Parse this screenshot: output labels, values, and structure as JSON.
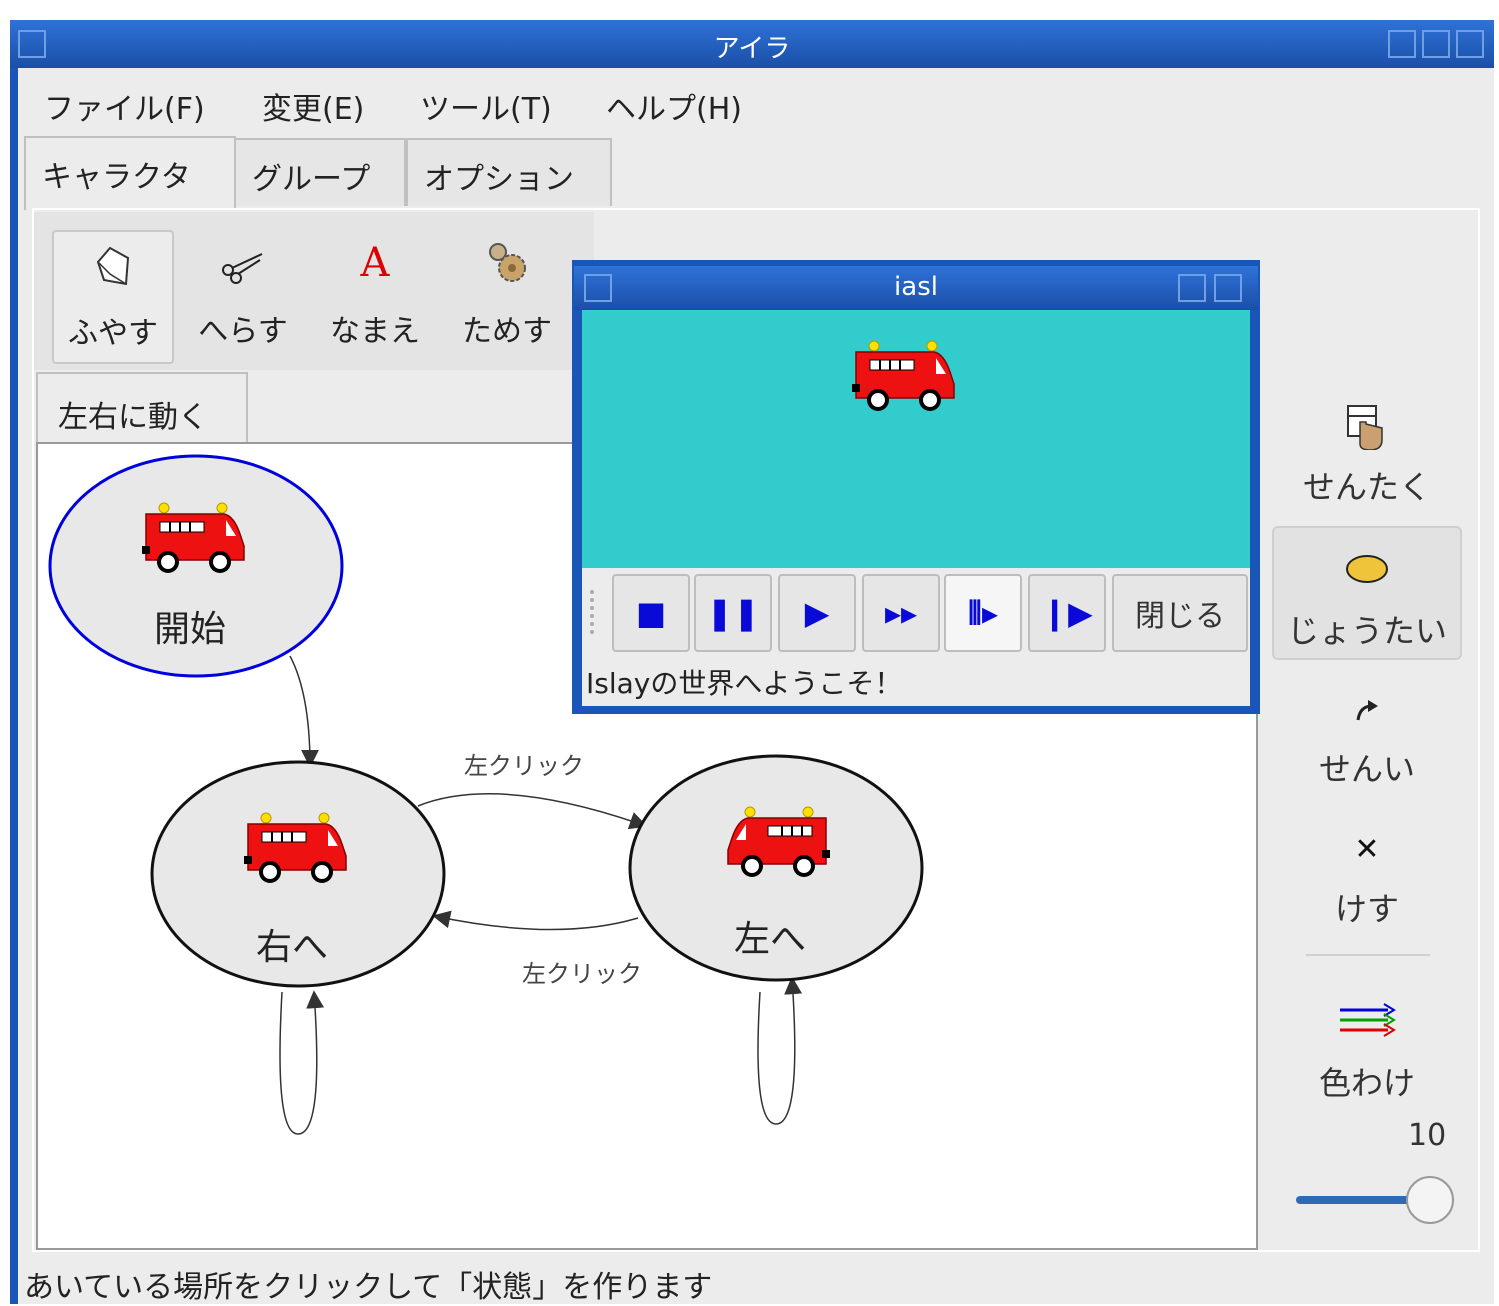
{
  "window": {
    "title": "アイラ"
  },
  "menu": [
    {
      "label": "ファイル(F)"
    },
    {
      "label": "変更(E)"
    },
    {
      "label": "ツール(T)"
    },
    {
      "label": "ヘルプ(H)"
    }
  ],
  "tabs": [
    {
      "label": "キャラクタ",
      "active": true
    },
    {
      "label": "グループ",
      "active": false
    },
    {
      "label": "オプション",
      "active": false
    }
  ],
  "toolbar": [
    {
      "label": "ふやす",
      "icon": "paper-icon",
      "selected": true
    },
    {
      "label": "へらす",
      "icon": "scissors-icon",
      "selected": false
    },
    {
      "label": "なまえ",
      "icon": "letter-a-icon",
      "selected": false
    },
    {
      "label": "ためす",
      "icon": "gear-icon",
      "selected": false
    }
  ],
  "subtab": {
    "label": "左右に動く"
  },
  "diagram": {
    "states": [
      {
        "label": "開始",
        "initial": true
      },
      {
        "label": "右へ",
        "initial": false
      },
      {
        "label": "左へ",
        "initial": false
      }
    ],
    "transitions": [
      {
        "label": "左クリック"
      },
      {
        "label": "左クリック"
      }
    ]
  },
  "palette": [
    {
      "label": "せんたく",
      "icon": "select-hand-icon",
      "selected": false
    },
    {
      "label": "じょうたい",
      "icon": "state-ellipse-icon",
      "selected": true
    },
    {
      "label": "せんい",
      "icon": "transition-arrow-icon",
      "selected": false
    },
    {
      "label": "けす",
      "icon": "delete-x-icon",
      "selected": false
    },
    {
      "label": "色わけ",
      "icon": "color-arrows-icon",
      "selected": false
    }
  ],
  "speed": {
    "value": "10"
  },
  "status": {
    "text": "あいている場所をクリックして「状態」を作ります"
  },
  "iasl": {
    "title": "iasl",
    "close_label": "閉じる",
    "message": "Islayの世界へようこそ！",
    "stage_color": "#33cccc",
    "controls": [
      {
        "name": "stop",
        "glyph": "■"
      },
      {
        "name": "pause",
        "glyph": "❚❚"
      },
      {
        "name": "play",
        "glyph": "▶"
      },
      {
        "name": "fast-forward",
        "glyph": "▸▸"
      },
      {
        "name": "slow",
        "glyph": "⦀▸"
      },
      {
        "name": "step",
        "glyph": "❙▶"
      }
    ]
  },
  "colors": {
    "titlebar": "#1a56b8",
    "accent_blue": "#0a0ad8",
    "initial_state_outline": "#0000dd"
  }
}
